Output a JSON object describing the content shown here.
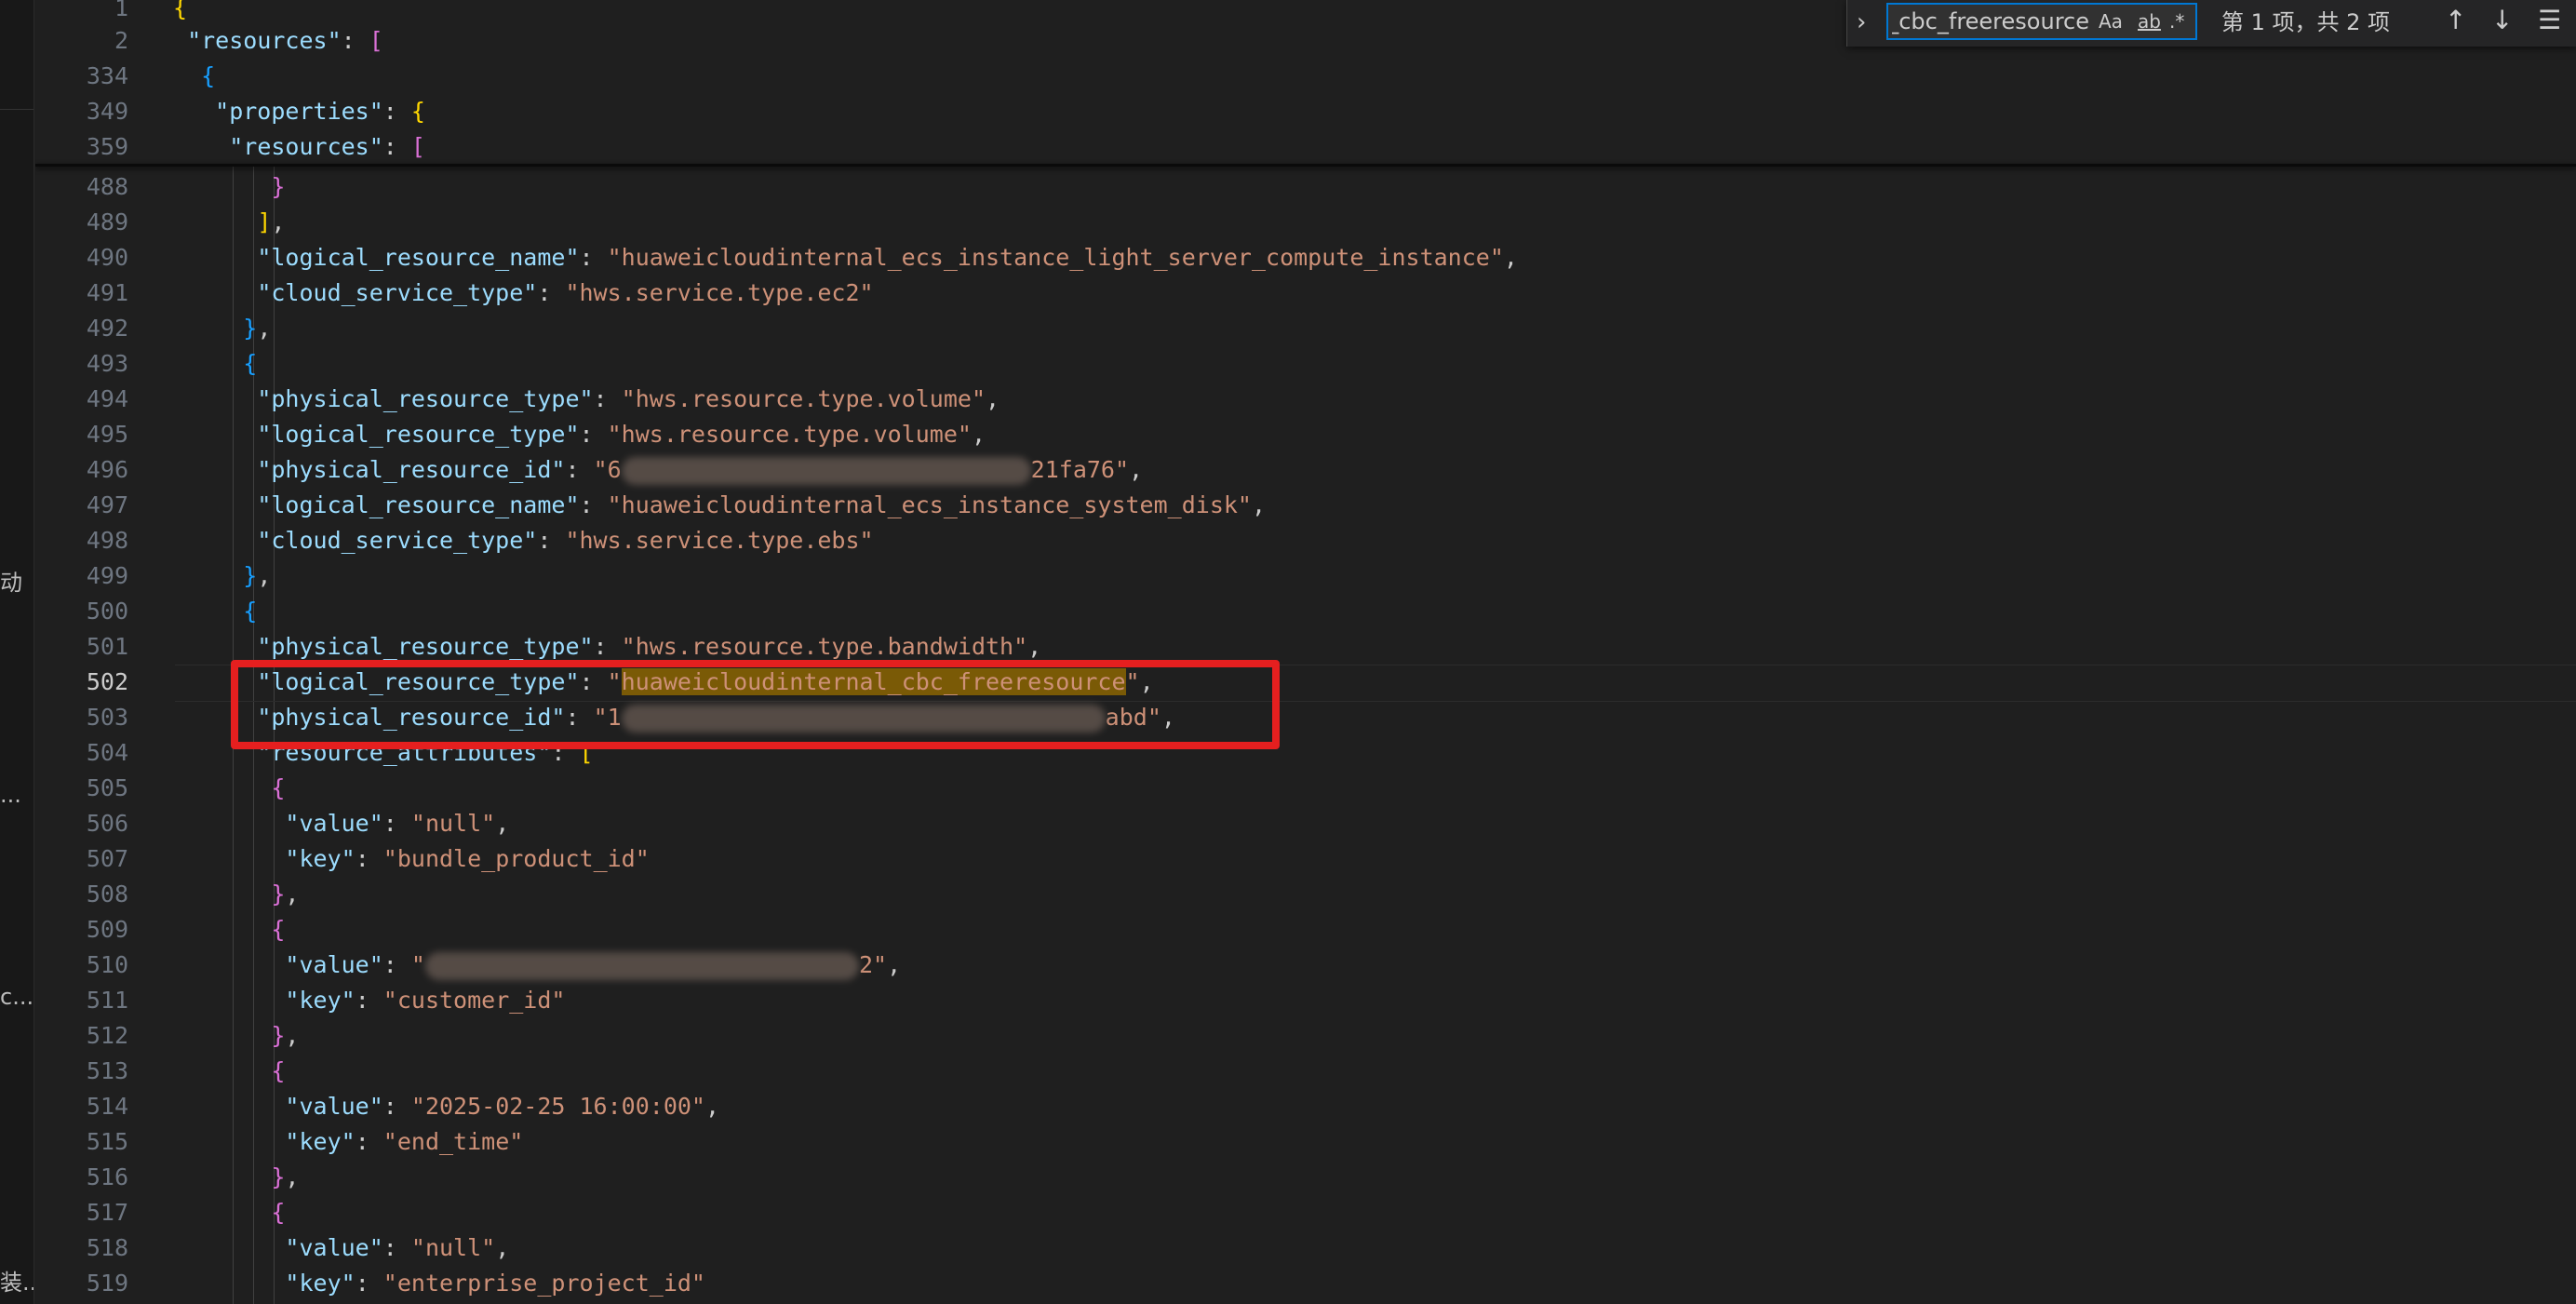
{
  "sidebar": {
    "fragments": [
      "动",
      "...",
      "c...",
      "装..."
    ]
  },
  "find_widget": {
    "search_value": "huaweicloudinternal_cbc_freeresource",
    "match_case_label": "Aa",
    "whole_word_label": "ab",
    "regex_label": ".*",
    "result_count": "第 1 项，共 2 项"
  },
  "editor": {
    "sticky_lines": [
      {
        "number": "1",
        "text": "{"
      },
      {
        "number": "2",
        "text": "  \"resources\": ["
      },
      {
        "number": "334",
        "text": "   {"
      },
      {
        "number": "349",
        "text": "    \"properties\": {"
      },
      {
        "number": "359",
        "text": "     \"resources\": ["
      }
    ],
    "lines": [
      {
        "number": "488",
        "text": "        }"
      },
      {
        "number": "489",
        "text": "       ],"
      },
      {
        "number": "490",
        "text": "       \"logical_resource_name\": \"huaweicloudinternal_ecs_instance_light_server_compute_instance\","
      },
      {
        "number": "491",
        "text": "       \"cloud_service_type\": \"hws.service.type.ec2\""
      },
      {
        "number": "492",
        "text": "      },"
      },
      {
        "number": "493",
        "text": "      {"
      },
      {
        "number": "494",
        "text": "       \"physical_resource_type\": \"hws.resource.type.volume\","
      },
      {
        "number": "495",
        "text": "       \"logical_resource_type\": \"hws.resource.type.volume\","
      },
      {
        "number": "496",
        "text": "       \"physical_resource_id\": \"6                             21fa76\","
      },
      {
        "number": "497",
        "text": "       \"logical_resource_name\": \"huaweicloudinternal_ecs_instance_system_disk\","
      },
      {
        "number": "498",
        "text": "       \"cloud_service_type\": \"hws.service.type.ebs\""
      },
      {
        "number": "499",
        "text": "      },"
      },
      {
        "number": "500",
        "text": "      {"
      },
      {
        "number": "501",
        "text": "       \"physical_resource_type\": \"hws.resource.type.bandwidth\","
      },
      {
        "number": "502",
        "text": "       \"logical_resource_type\": \"huaweicloudinternal_cbc_freeresource\","
      },
      {
        "number": "503",
        "text": "       \"physical_resource_id\": \"1                          abd\","
      },
      {
        "number": "504",
        "text": "       \"resource_attributes\": ["
      },
      {
        "number": "505",
        "text": "        {"
      },
      {
        "number": "506",
        "text": "         \"value\": \"null\","
      },
      {
        "number": "507",
        "text": "         \"key\": \"bundle_product_id\""
      },
      {
        "number": "508",
        "text": "        },"
      },
      {
        "number": "509",
        "text": "        {"
      },
      {
        "number": "510",
        "text": "         \"value\": \"                              2\","
      },
      {
        "number": "511",
        "text": "         \"key\": \"customer_id\""
      },
      {
        "number": "512",
        "text": "        },"
      },
      {
        "number": "513",
        "text": "        {"
      },
      {
        "number": "514",
        "text": "         \"value\": \"2025-02-25 16:00:00\","
      },
      {
        "number": "515",
        "text": "         \"key\": \"end_time\""
      },
      {
        "number": "516",
        "text": "        },"
      },
      {
        "number": "517",
        "text": "        {"
      },
      {
        "number": "518",
        "text": "         \"value\": \"null\","
      },
      {
        "number": "519",
        "text": "         \"key\": \"enterprise_project_id\""
      }
    ]
  },
  "colors": {
    "background": "#1f1f1f",
    "key": "#9cdcfe",
    "string": "#ce9178",
    "find_highlight": "#7a5a06",
    "annotation_box": "#e51f1f"
  }
}
